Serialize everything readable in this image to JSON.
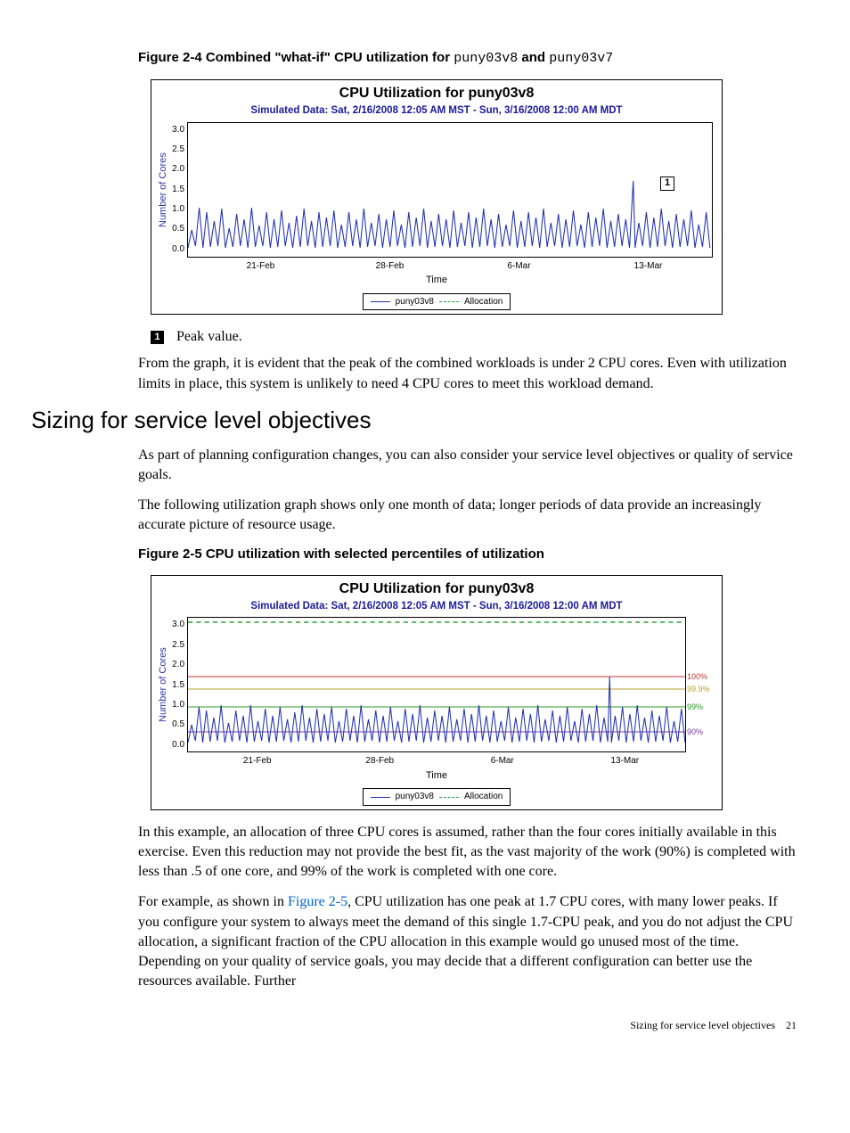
{
  "fig24": {
    "caption_prefix": "Figure 2-4 Combined \"what-if\" CPU utilization for ",
    "code1": "puny03v8",
    "and": " and ",
    "code2": "puny03v7",
    "title": "CPU Utilization for puny03v8",
    "subtitle": "Simulated Data: Sat, 2/16/2008 12:05 AM MST - Sun, 3/16/2008 12:00 AM MDT",
    "ylabel": "Number of Cores",
    "xlabel": "Time",
    "yticks": [
      "3.0",
      "2.5",
      "2.0",
      "1.5",
      "1.0",
      "0.5",
      "0.0"
    ],
    "xticks": [
      "21-Feb",
      "28-Feb",
      "6-Mar",
      "13-Mar"
    ],
    "legend": {
      "s1": "puny03v8",
      "s2": "Allocation"
    },
    "callout1": "1"
  },
  "callout_label": "1",
  "callout_text": "Peak value.",
  "para1": "From the graph, it is evident that the peak of the combined workloads is under 2 CPU cores. Even with utilization limits in place, this system is unlikely to need 4 CPU cores to meet this workload demand.",
  "h2": "Sizing for service level objectives",
  "para2": "As part of planning configuration changes, you can also consider your service level objectives or quality of service goals.",
  "para3": "The following utilization graph shows only one month of data; longer periods of data provide an increasingly accurate picture of resource usage.",
  "fig25": {
    "caption": "Figure 2-5  CPU utilization with selected percentiles of utilization",
    "title": "CPU Utilization for puny03v8",
    "subtitle": "Simulated Data: Sat, 2/16/2008 12:05 AM MST - Sun, 3/16/2008 12:00 AM MDT",
    "ylabel": "Number of Cores",
    "xlabel": "Time",
    "yticks": [
      "3.0",
      "2.5",
      "2.0",
      "1.5",
      "1.0",
      "0.5",
      "0.0"
    ],
    "xticks": [
      "21-Feb",
      "28-Feb",
      "6-Mar",
      "13-Mar"
    ],
    "legend": {
      "s1": "puny03v8",
      "s2": "Allocation"
    },
    "pct": {
      "p100": "100%",
      "p999": "99.9%",
      "p99": "99%",
      "p90": "90%"
    }
  },
  "para4": "In this example, an allocation of three CPU cores is assumed, rather than the four cores initially available in this exercise. Even this reduction may not provide the best fit, as the vast majority of the work (90%) is completed with less than .5 of one core, and 99% of the work is completed with one core.",
  "para5a": "For example, as shown in ",
  "para5link": "Figure 2-5",
  "para5b": ", CPU utilization has one peak at 1.7 CPU cores, with many lower peaks. If you configure your system to always meet the demand of this single 1.7-CPU peak, and you do not adjust the CPU allocation, a significant fraction of the CPU allocation in this example would go unused most of the time. Depending on your quality of service goals, you may decide that a different configuration can better use the resources available. Further",
  "footer": {
    "text": "Sizing for service level objectives",
    "page": "21"
  },
  "chart_data": [
    {
      "figure": "2-4",
      "type": "line",
      "title": "CPU Utilization for puny03v8",
      "xlabel": "Time",
      "ylabel": "Number of Cores",
      "ylim": [
        0,
        3.1
      ],
      "x_range": [
        "2008-02-16",
        "2008-03-16"
      ],
      "x_ticks": [
        "21-Feb",
        "28-Feb",
        "6-Mar",
        "13-Mar"
      ],
      "series": [
        {
          "name": "puny03v8",
          "style": "solid",
          "description": "high-frequency utilization samples; baseline approx 0.2–0.3 cores with frequent spikes mostly to 0.8–1.2; one isolated peak approx 1.7 cores around 13-Mar (annotated 1)"
        },
        {
          "name": "Allocation",
          "style": "dashed",
          "description": "allocation reference line (not visibly drawn in this crop)"
        }
      ],
      "annotations": [
        {
          "label": "1",
          "approx_x": "2008-03-13",
          "approx_y": 1.7,
          "meaning": "Peak value"
        }
      ]
    },
    {
      "figure": "2-5",
      "type": "line",
      "title": "CPU Utilization for puny03v8",
      "xlabel": "Time",
      "ylabel": "Number of Cores",
      "ylim": [
        0,
        3.1
      ],
      "x_range": [
        "2008-02-16",
        "2008-03-16"
      ],
      "x_ticks": [
        "21-Feb",
        "28-Feb",
        "6-Mar",
        "13-Mar"
      ],
      "series": [
        {
          "name": "puny03v8",
          "style": "solid",
          "description": "same utilization trace as Fig 2-4; baseline approx 0.2–0.3; frequent spikes to approx 1.0; one peak approx 1.7 near 13-Mar"
        },
        {
          "name": "Allocation",
          "style": "dashed",
          "value_constant": 3.0
        }
      ],
      "percentile_markers": [
        {
          "label": "100%",
          "value": 1.7
        },
        {
          "label": "99.9%",
          "value": 1.4
        },
        {
          "label": "99%",
          "value": 1.0
        },
        {
          "label": "90%",
          "value": 0.45
        }
      ]
    }
  ]
}
